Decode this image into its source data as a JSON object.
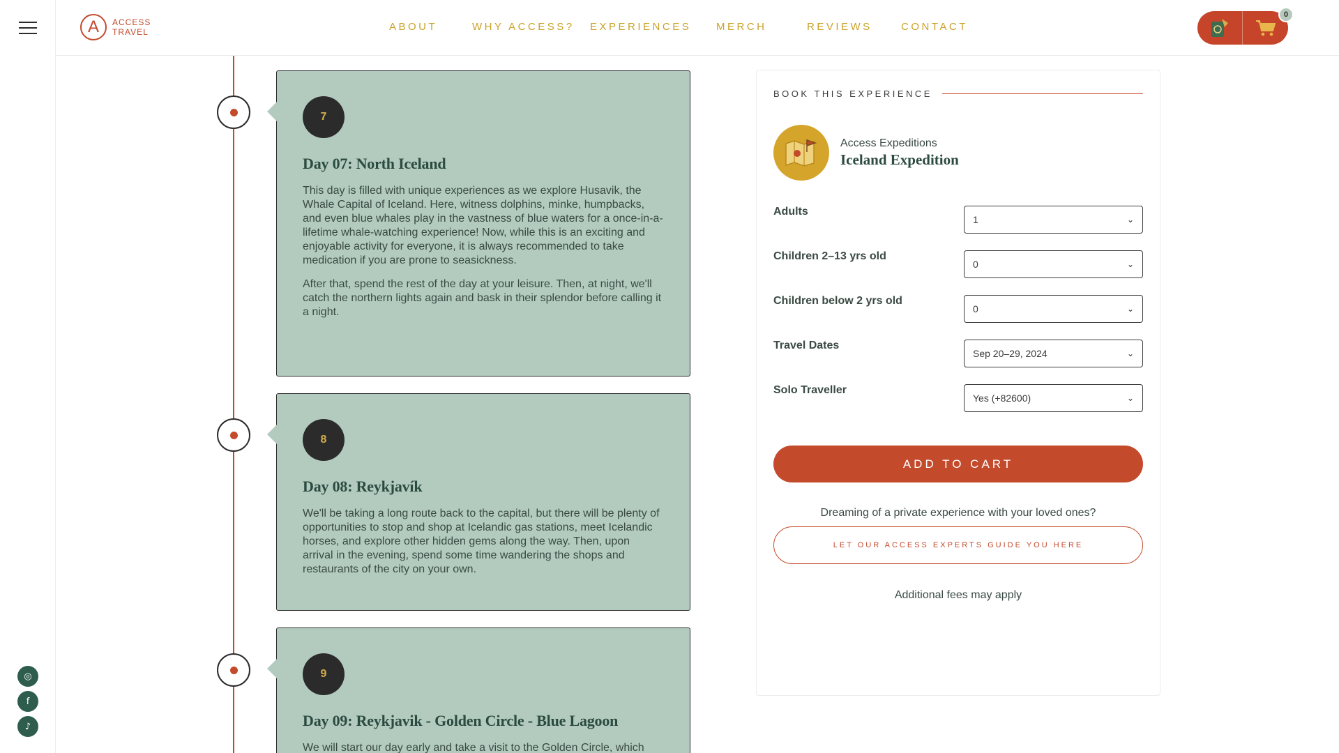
{
  "header": {
    "logo_line1": "ACCESS",
    "logo_line2": "TRAVEL",
    "nav": [
      "ABOUT",
      "WHY ACCESS?",
      "EXPERIENCES",
      "MERCH",
      "REVIEWS",
      "CONTACT"
    ],
    "cart_count": "0"
  },
  "timeline": [
    {
      "number": "7",
      "title": "Day 07: North Iceland",
      "paragraphs": [
        "This day is filled with unique experiences as we explore Husavik, the Whale Capital of Iceland. Here, witness dolphins, minke, humpbacks, and even blue whales play in the vastness of blue waters for a once-in-a-lifetime whale-watching experience! Now, while this is an exciting and enjoyable activity for everyone, it is always recommended to take medication if you are prone to seasickness.",
        "After that, spend the rest of the day at your leisure. Then, at night, we'll catch the northern lights again and bask in their splendor before calling it a night."
      ]
    },
    {
      "number": "8",
      "title": "Day 08: Reykjavík",
      "paragraphs": [
        "We'll be taking a long route back to the capital, but there will be plenty of opportunities to stop and shop at Icelandic gas stations, meet Icelandic horses, and explore other hidden gems along the way. Then, upon arrival in the evening, spend some time wandering the shops and restaurants of the city on your own."
      ]
    },
    {
      "number": "9",
      "title": "Day 09: Reykjavik - Golden Circle - Blue Lagoon",
      "paragraphs": [
        "We will start our day early and take a visit to the Golden Circle, which"
      ]
    }
  ],
  "booking": {
    "heading": "BOOK THIS EXPERIENCE",
    "brand": "Access Expeditions",
    "product": "Iceland Expedition",
    "options": [
      {
        "label": "Adults",
        "value": "1"
      },
      {
        "label": "Children 2–13 yrs old",
        "value": "0"
      },
      {
        "label": "Children below 2 yrs old",
        "value": "0"
      },
      {
        "label": "Travel Dates",
        "value": "Sep 20–29, 2024"
      },
      {
        "label": "Solo Traveller",
        "value": "Yes (+82600)"
      }
    ],
    "add_to_cart": "ADD TO CART",
    "dream_text": "Dreaming of a private experience with your loved ones?",
    "experts_button": "LET OUR ACCESS EXPERTS GUIDE YOU HERE",
    "fees_note": "Additional fees may apply"
  },
  "colors": {
    "accent": "#c44a2c",
    "gold": "#c9a227",
    "card": "#b3cbbf",
    "dark": "#2b2b2b"
  }
}
